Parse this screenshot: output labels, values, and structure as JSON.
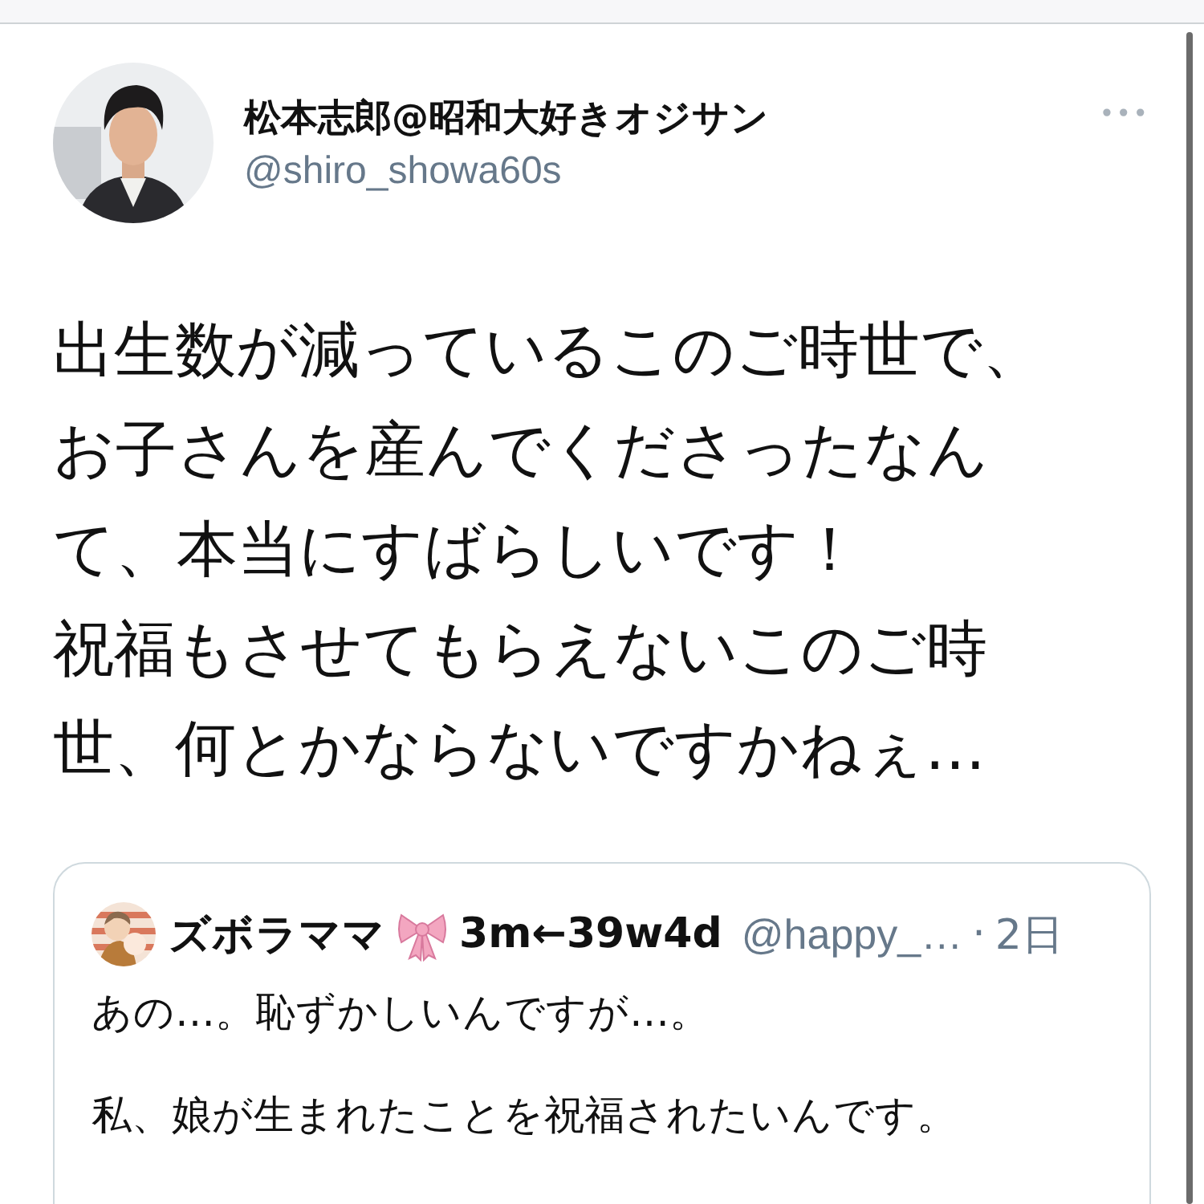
{
  "tweet": {
    "author": {
      "name": "松本志郎@昭和大好きオジサン",
      "handle": "@shiro_showa60s"
    },
    "more": "•••",
    "text_lines": [
      "出生数が減っているこのご時世で、",
      "お子さんを産んでくださったなん",
      "て、本当にすばらしいです！",
      "祝福もさせてもらえないこのご時",
      "世、何とかならないですかねぇ…"
    ]
  },
  "quoted_tweet": {
    "author": {
      "name": "ズボラママ",
      "name_suffix": "3m←39w4d",
      "handle": "@happy_…",
      "separator": "·",
      "time": "2日"
    },
    "paragraphs": [
      "あの…。恥ずかしいんですが…。",
      "私、娘が生まれたことを祝福されたいんです。"
    ]
  }
}
